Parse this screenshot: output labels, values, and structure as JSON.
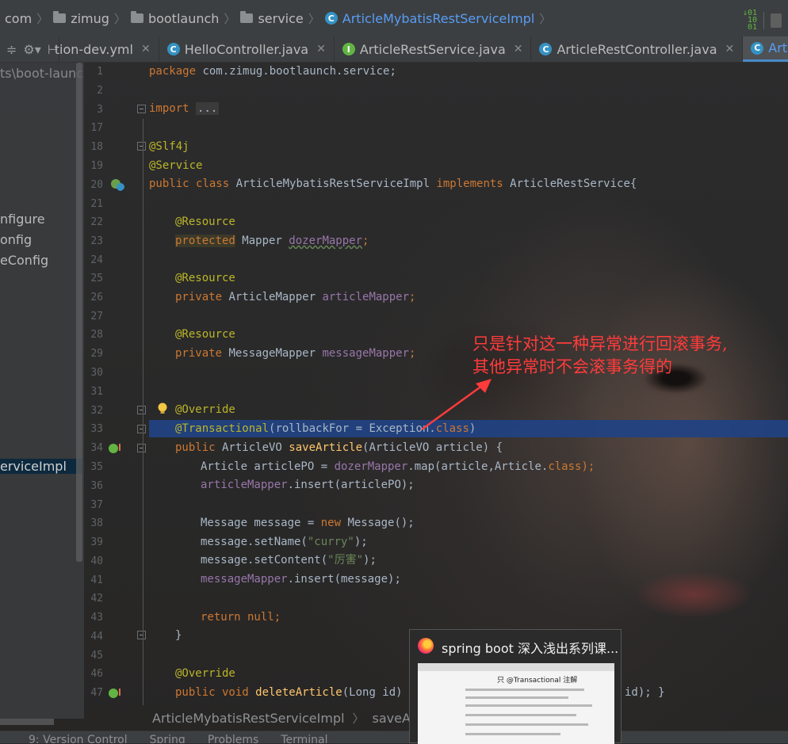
{
  "breadcrumb": {
    "items": [
      "com",
      "zimug",
      "bootlaunch",
      "service"
    ],
    "current": "ArticleMybatisRestServiceImpl"
  },
  "tabs": [
    {
      "label": "tion-dev.yml",
      "icon": "yaml"
    },
    {
      "label": "HelloController.java",
      "icon": "C"
    },
    {
      "label": "ArticleRestService.java",
      "icon": "I"
    },
    {
      "label": "ArticleRestController.java",
      "icon": "C"
    },
    {
      "label": "ArticleM",
      "icon": "C",
      "active": true
    }
  ],
  "project": {
    "path": "ts\\boot-launch",
    "items": [
      "nfigure",
      "onfig",
      "eConfig",
      "erviceImpl"
    ]
  },
  "lines": [
    {
      "n": "1"
    },
    {
      "n": "2"
    },
    {
      "n": "3"
    },
    {
      "n": "17"
    },
    {
      "n": "18"
    },
    {
      "n": "19"
    },
    {
      "n": "20"
    },
    {
      "n": "21"
    },
    {
      "n": "22"
    },
    {
      "n": "23"
    },
    {
      "n": "24"
    },
    {
      "n": "25"
    },
    {
      "n": "26"
    },
    {
      "n": "27"
    },
    {
      "n": "28"
    },
    {
      "n": "29"
    },
    {
      "n": "30"
    },
    {
      "n": "31"
    },
    {
      "n": "32"
    },
    {
      "n": "33"
    },
    {
      "n": "34"
    },
    {
      "n": "35"
    },
    {
      "n": "36"
    },
    {
      "n": "37"
    },
    {
      "n": "38"
    },
    {
      "n": "39"
    },
    {
      "n": "40"
    },
    {
      "n": "41"
    },
    {
      "n": "42"
    },
    {
      "n": "43"
    },
    {
      "n": "44"
    },
    {
      "n": "45"
    },
    {
      "n": "46"
    },
    {
      "n": "47"
    }
  ],
  "code": {
    "l1_kw": "package",
    "l1_rest": " com.zimug.bootlaunch.service;",
    "l3_kw": "import",
    "l3_fold": "...",
    "l18": "@Slf4j",
    "l19": "@Service",
    "l20_kw": "public class",
    "l20_name": " ArticleMybatisRestServiceImpl ",
    "l20_kw2": "implements",
    "l20_rest": " ArticleRestService{",
    "l22": "@Resource",
    "l23_kw": "protected",
    "l23_type": " Mapper ",
    "l23_fld": "dozerMapper",
    "l23_end": ";",
    "l25": "@Resource",
    "l26_kw": "private",
    "l26_type": " ArticleMapper ",
    "l26_fld": "articleMapper",
    "l26_end": ";",
    "l28": "@Resource",
    "l29_kw": "private",
    "l29_type": " MessageMapper ",
    "l29_fld": "messageMapper",
    "l29_end": ";",
    "l32": "@Override",
    "l33_an": "@Transactional",
    "l33_rest": "(rollbackFor = Exception.",
    "l33_kw": "class",
    "l33_end": ")",
    "l34_kw": "public",
    "l34_type": " ArticleVO ",
    "l34_mth": "saveArticle",
    "l34_rest": "(ArticleVO article) {",
    "l35_a": "Article articlePO = ",
    "l35_fld": "dozerMapper",
    "l35_b": ".map(article,Article.",
    "l35_kw": "class",
    "l35_end": ");",
    "l36_fld": "articleMapper",
    "l36_rest": ".insert(articlePO);",
    "l38_a": "Message message = ",
    "l38_kw": "new",
    "l38_b": " Message();",
    "l39_a": "message.setName(",
    "l39_str": "\"curry\"",
    "l39_end": ");",
    "l40_a": "message.setContent(",
    "l40_str": "\"厉害\"",
    "l40_end": ");",
    "l41_fld": "messageMapper",
    "l41_rest": ".insert(message);",
    "l43_kw": "return null",
    "l43_end": ";",
    "l44": "}",
    "l46": "@Override",
    "l47_kw": "public void",
    "l47_mth": " deleteArticle",
    "l47_rest": "(Long id) {",
    "l47_tail": "id); }"
  },
  "annotation": {
    "line1": "只是针对这一种异常进行回滚事务,",
    "line2": "其他异常时不会滚事务得的"
  },
  "bottom_breadcrumb": [
    "ArticleMybatisRestServiceImpl",
    "saveArticl"
  ],
  "tool_windows": [
    "9: Version Control",
    "Spring",
    "Problems",
    "Terminal"
  ],
  "popup": {
    "title": "spring boot 深入浅出系列课...",
    "thumb_heading": "只 @Transactional 注解"
  }
}
